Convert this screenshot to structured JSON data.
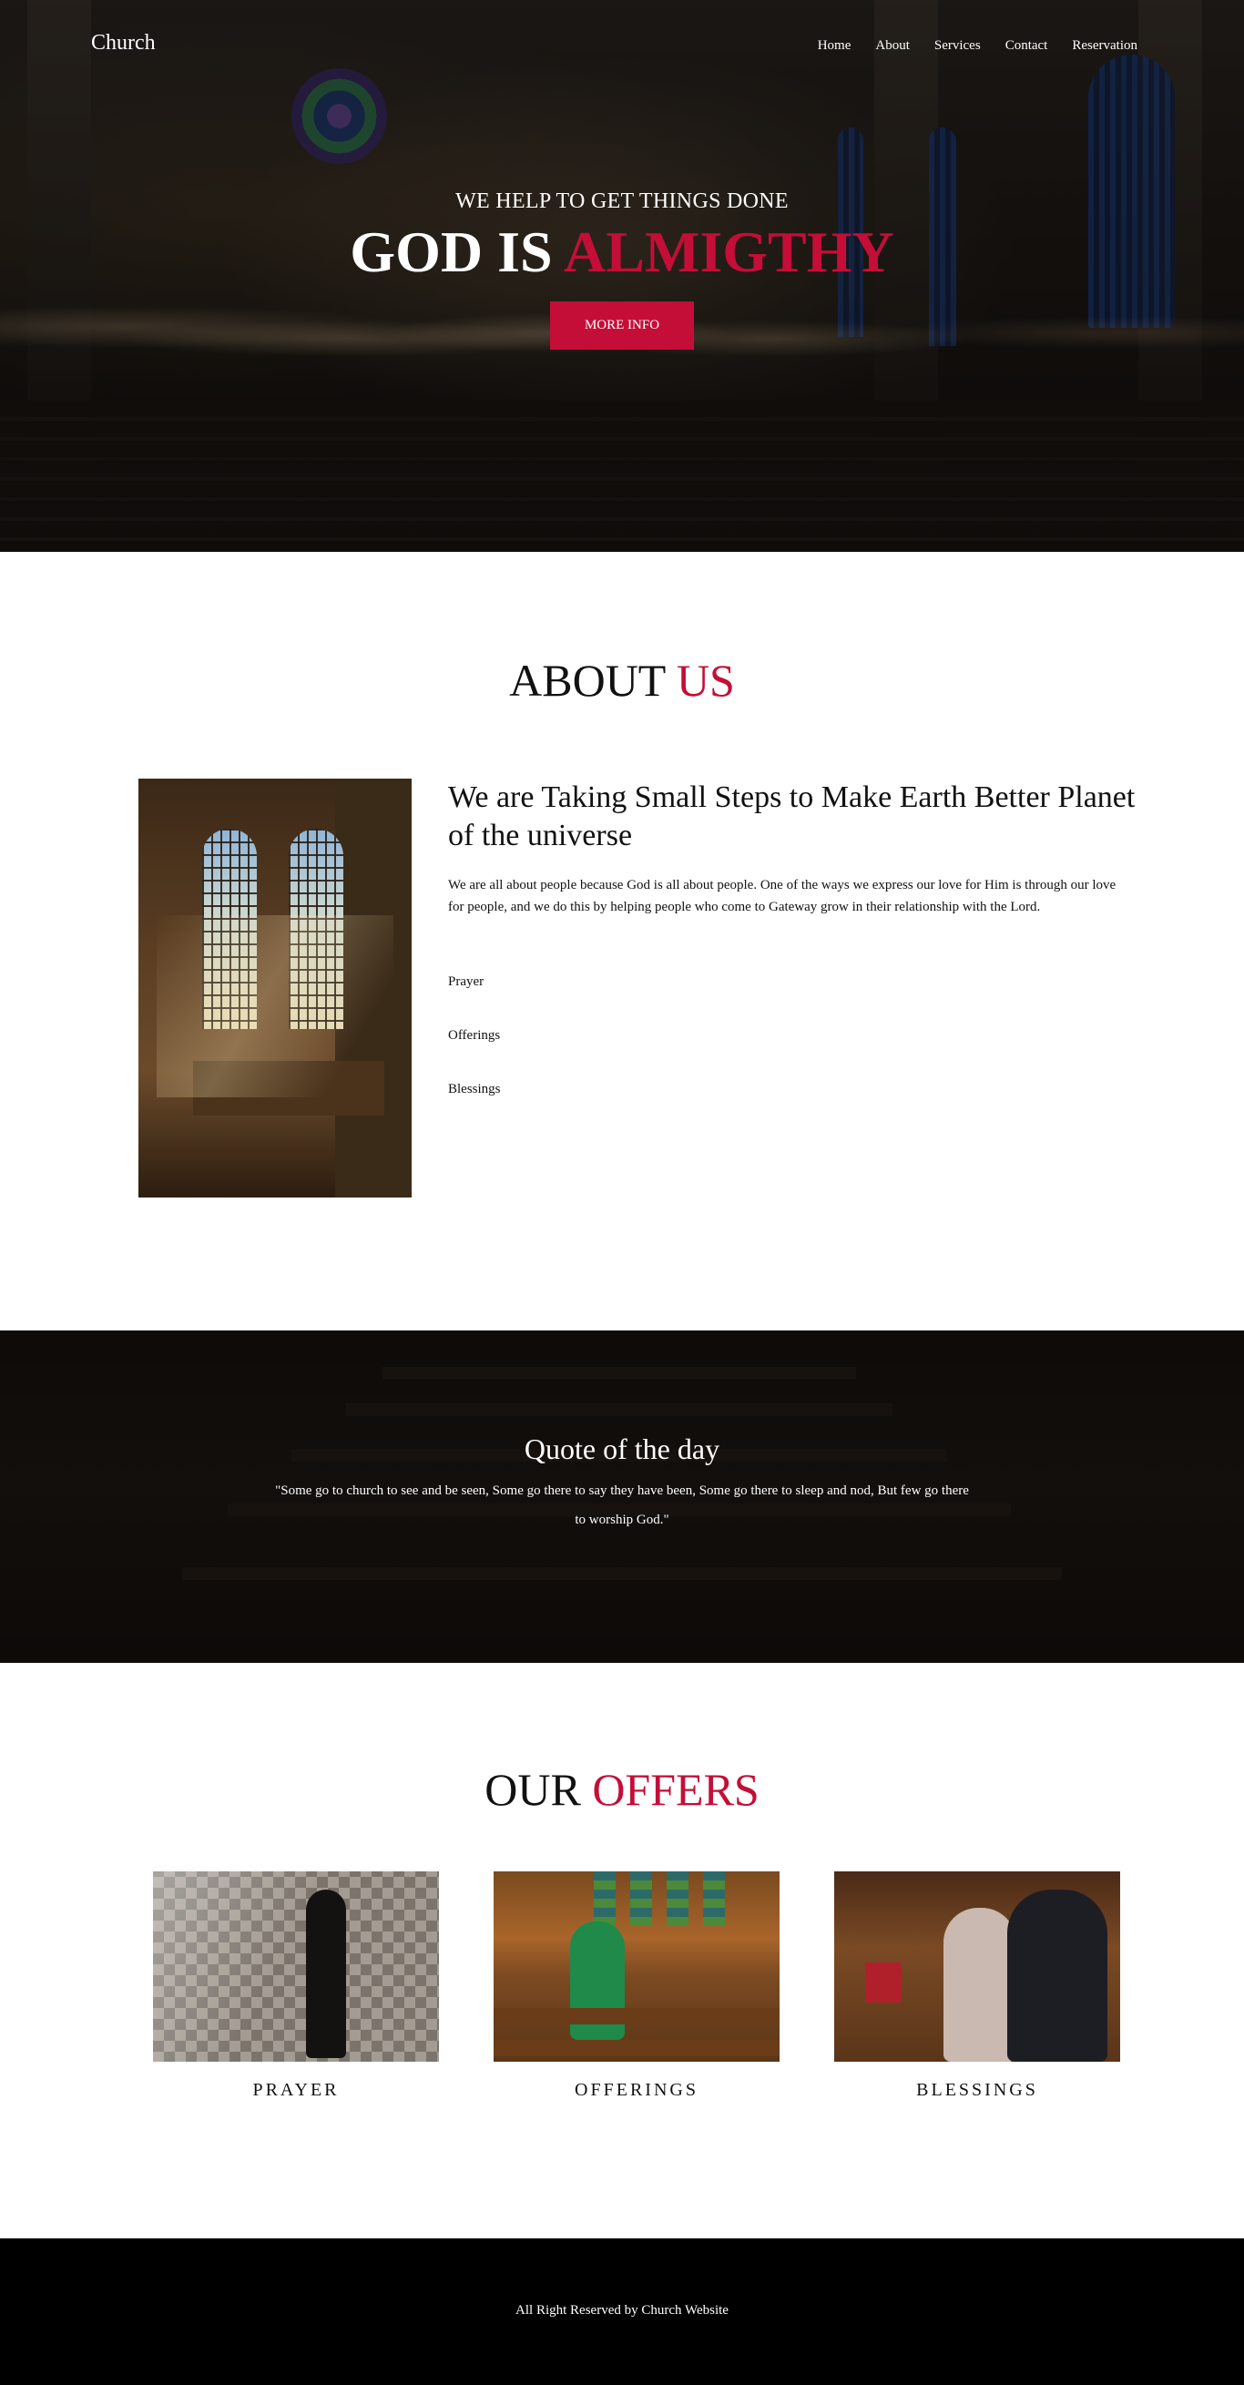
{
  "nav": {
    "brand": "Church",
    "items": [
      "Home",
      "About",
      "Services",
      "Contact",
      "Reservation"
    ]
  },
  "hero": {
    "subtitle": "WE HELP TO GET THINGS DONE",
    "title_main": "GOD IS ",
    "title_accent": "ALMIGTHY",
    "button": "MORE INFO"
  },
  "about": {
    "title_main": "ABOUT ",
    "title_accent": "US",
    "heading": "We are Taking Small Steps to Make Earth Better Planet of the universe",
    "paragraph": "We are all about people because God is all about people. One of the ways we express our love for Him is through our love for people, and we do this by helping people who come to Gateway grow in their relationship with the Lord.",
    "items": [
      "Prayer",
      "Offerings",
      "Blessings"
    ]
  },
  "quote": {
    "title": "Quote of the day",
    "text": "\"Some go to church to see and be seen, Some go there to say they have been, Some go there to sleep and nod, But few go there to worship God.\""
  },
  "offers": {
    "title_main": "OUR ",
    "title_accent": "OFFERS",
    "cards": [
      {
        "label": "PRAYER"
      },
      {
        "label": "OFFERINGS"
      },
      {
        "label": "BLESSINGS"
      }
    ]
  },
  "footer": {
    "text": "All Right Reserved by Church Website"
  },
  "colors": {
    "accent": "#c40e37",
    "footer_bg": "#000000"
  }
}
